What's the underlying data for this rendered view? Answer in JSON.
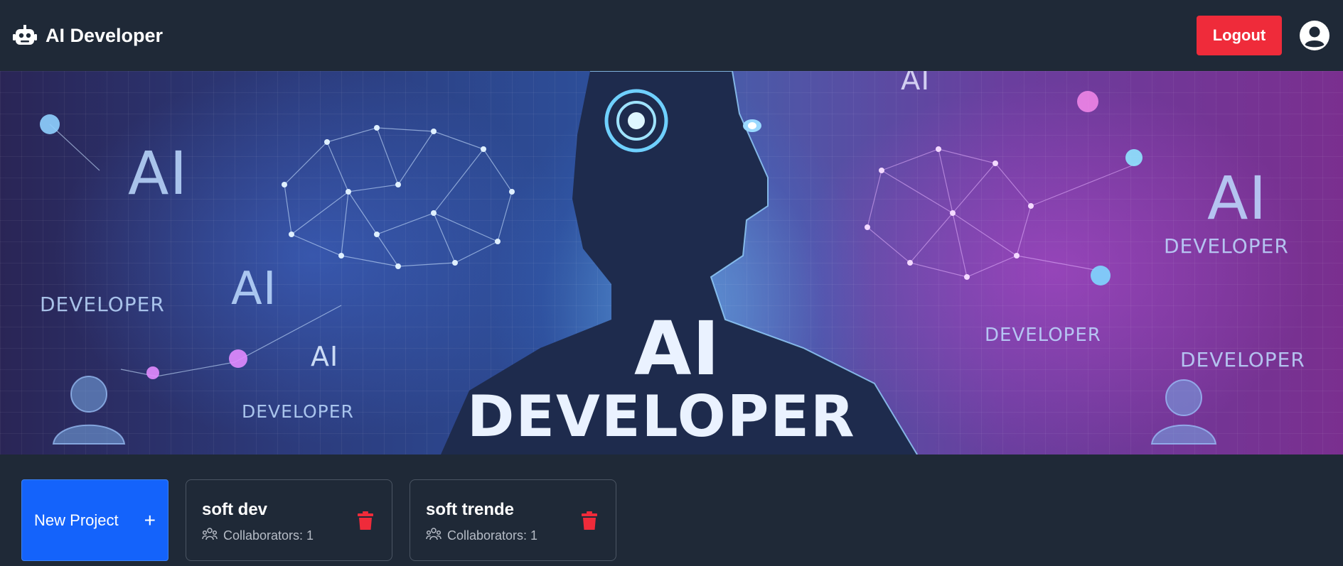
{
  "navbar": {
    "title": "AI Developer",
    "logout_label": "Logout",
    "brand_icon": "robot-icon",
    "avatar_icon": "user-circle-icon"
  },
  "banner": {
    "main_title": "AI",
    "main_subtitle": "DEVELOPER",
    "texts": [
      "AI",
      "AI",
      "AI",
      "AI",
      "AI",
      "DEVELOPER",
      "DEVELOPER",
      "DEVELOPER",
      "DEVELOPER",
      "DEVELOPER"
    ]
  },
  "new_project": {
    "label": "New Project",
    "icon": "+"
  },
  "projects": [
    {
      "name": "soft dev",
      "collaborators_label": "Collaborators: 1"
    },
    {
      "name": "soft trende",
      "collaborators_label": "Collaborators: 1"
    }
  ],
  "colors": {
    "background": "#1f2937",
    "logout": "#ef2b3a",
    "primary": "#1463fb",
    "trash": "#ef2b3a"
  }
}
